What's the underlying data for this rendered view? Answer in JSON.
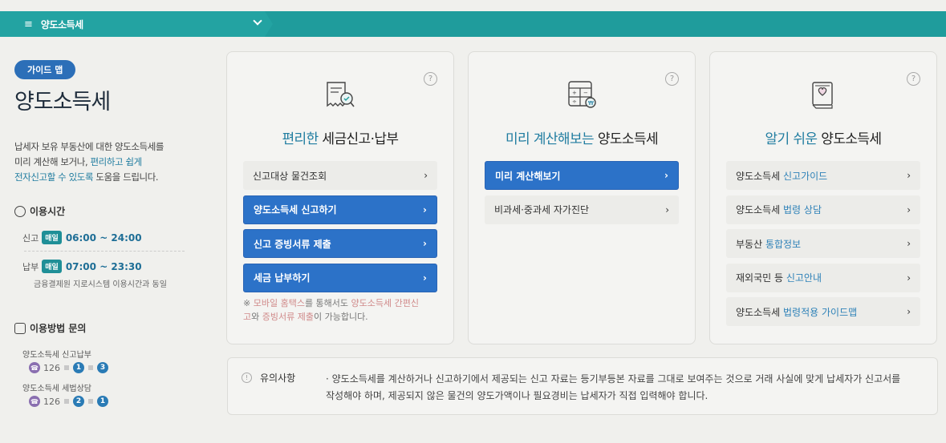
{
  "topbar": {
    "title": "양도소득세",
    "menu_icon": "≡"
  },
  "left": {
    "guide_badge": "가이드 맵",
    "title": "양도소득세",
    "desc_1": "납세자 보유 부동산에 대한 양도소득세를",
    "desc_2a": "미리 계산해 보거나, ",
    "desc_2b": "편리하고 쉽게",
    "desc_3a": "전자신고할 수 있도록",
    "desc_3b": " 도움을 드립니다.",
    "hours_title": "이용시간",
    "hours": [
      {
        "label": "신고",
        "badge": "매일",
        "time": "06:00 ~ 24:00"
      },
      {
        "label": "납부",
        "badge": "매일",
        "time": "07:00 ~ 23:30"
      }
    ],
    "hours_note": "금융결제원 지로시스템 이용시간과 동일",
    "inquiry_title": "이용방법 문의",
    "inquiries": [
      {
        "label": "양도소득세 신고납부",
        "number": "126",
        "d1": "1",
        "d2": "3"
      },
      {
        "label": "양도소득세 세법상담",
        "number": "126",
        "d1": "2",
        "d2": "1"
      }
    ]
  },
  "cards": [
    {
      "title_hl": "편리한",
      "title_rest": " 세금신고·납부",
      "items": [
        "신고대상 물건조회",
        "양도소득세 신고하기",
        "신고 증빙서류 제출",
        "세금 납부하기"
      ],
      "note": {
        "a": "※ ",
        "b": "모바일 홈택스",
        "c": "를 통해서도 ",
        "d": "양도소득세 간편신고",
        "e": "와 ",
        "f": "증빙서류 제출",
        "g": "이 가능합니다."
      }
    },
    {
      "title_hl": "미리 계산해보는",
      "title_rest": " 양도소득세",
      "items": [
        "미리 계산해보기",
        "비과세·중과세 자가진단"
      ]
    },
    {
      "title_hl": "알기 쉬운",
      "title_rest": " 양도소득세",
      "items": [
        {
          "a": "양도소득세 ",
          "b": "신고가이드"
        },
        {
          "a": "양도소득세 ",
          "b": "법령 상담"
        },
        {
          "a": "부동산 ",
          "b": "통합정보"
        },
        {
          "a": "재외국민 등 ",
          "b": "신고안내"
        },
        {
          "a": "양도소득세 ",
          "b": "법령적용 가이드맵"
        }
      ]
    }
  ],
  "notice": {
    "title": "유의사항",
    "text": "· 양도소득세를 계산하거나 신고하기에서 제공되는 신고 자료는 등기부등본 자료를 그대로 보여주는 것으로 거래 사실에 맞게 납세자가 신고서를 작성해야 하며, 제공되지 않은 물건의 양도가액이나 필요경비는 납세자가 직접 입력해야 합니다."
  },
  "help_icon": "?",
  "accent": "#1f9c9c"
}
